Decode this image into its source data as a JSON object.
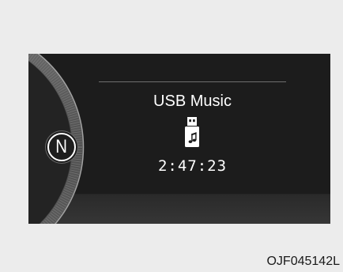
{
  "display": {
    "gear": "N",
    "source_title": "USB Music",
    "source_icon": "usb-music-icon",
    "play_time": "2:47:23"
  },
  "caption": "OJF045142L",
  "colors": {
    "page_background": "#ececec",
    "panel_background": "#1c1c1c",
    "text": "#ffffff"
  }
}
